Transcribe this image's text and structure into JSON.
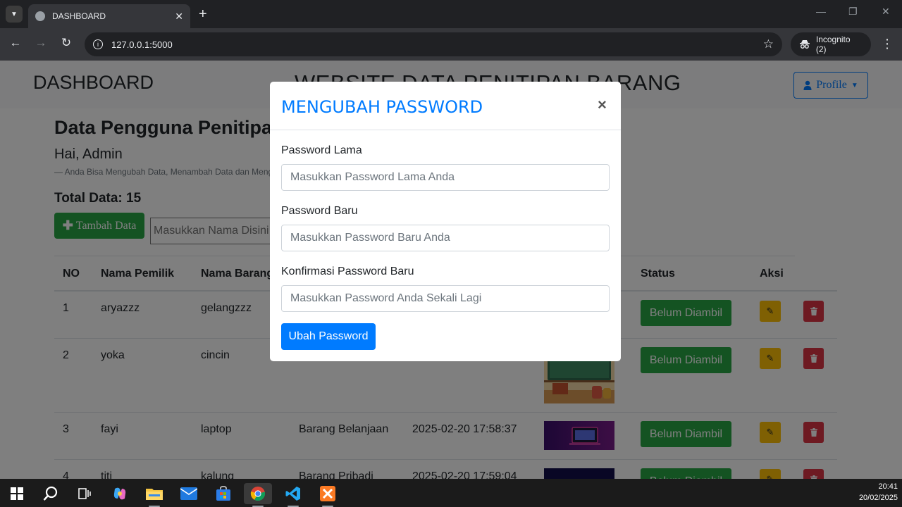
{
  "browser": {
    "tab_title": "DASHBOARD",
    "url": "127.0.0.1:5000",
    "incognito_label": "Incognito (2)"
  },
  "navbar": {
    "brand": "DASHBOARD",
    "site_title": "WEBSITE DATA PENITIPAN BARANG",
    "profile_label": "Profile"
  },
  "content": {
    "heading": "Data Pengguna Penitipan Barang",
    "greeting": "Hai, Admin",
    "note": "—  Anda Bisa Mengubah Data, Menambah Data dan Menghapus Data",
    "total": "Total Data: 15",
    "add_button": "Tambah Data",
    "search_placeholder": "Masukkan Nama Disini..."
  },
  "table": {
    "headers": [
      "NO",
      "Nama Pemilik",
      "Nama Barang",
      "Status",
      "Aksi"
    ],
    "rows": [
      {
        "no": "1",
        "pemilik": "aryazzz",
        "barang": "gelangzzz",
        "jenis": "",
        "tanggal": "",
        "status": "Belum Diambil"
      },
      {
        "no": "2",
        "pemilik": "yoka",
        "barang": "cincin",
        "jenis": "",
        "tanggal": "",
        "status": "Belum Diambil"
      },
      {
        "no": "3",
        "pemilik": "fayi",
        "barang": "laptop",
        "jenis": "Barang Belanjaan",
        "tanggal": "2025-02-20 17:58:37",
        "status": "Belum Diambil"
      },
      {
        "no": "4",
        "pemilik": "titi",
        "barang": "kalung",
        "jenis": "Barang Pribadi",
        "tanggal": "2025-02-20 17:59:04",
        "status": "Belum Diambil"
      }
    ]
  },
  "modal": {
    "title": "MENGUBAH PASSWORD",
    "close": "×",
    "old_label": "Password Lama",
    "old_placeholder": "Masukkan Password Lama Anda",
    "new_label": "Password Baru",
    "new_placeholder": "Masukkan Password Baru Anda",
    "confirm_label": "Konfirmasi Password Baru",
    "confirm_placeholder": "Masukkan Password Anda Sekali Lagi",
    "submit": "Ubah Password"
  },
  "taskbar": {
    "time": "20:41",
    "date": "20/02/2025"
  },
  "colors": {
    "primary": "#007bff",
    "success": "#28a745",
    "warning": "#ffc107",
    "danger": "#dc3545"
  }
}
